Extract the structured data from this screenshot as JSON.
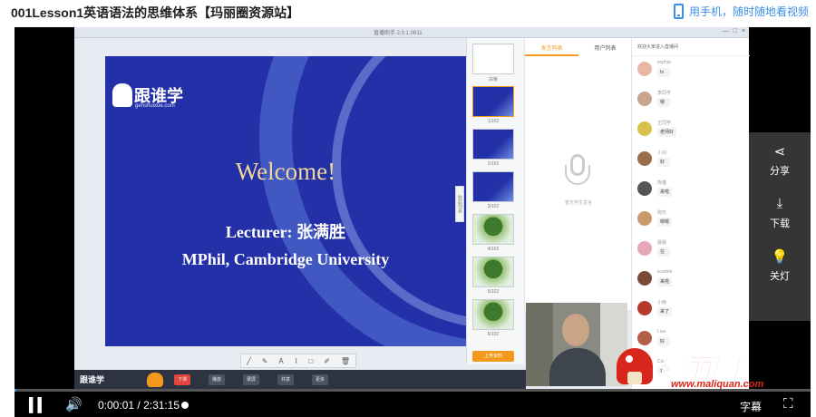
{
  "header": {
    "title": "001Lesson1英语语法的思维体系【玛丽圈资源站】",
    "mobile_hint": "用手机，随时随地看视频"
  },
  "app": {
    "title": "直播助手 2.0.1.0611",
    "window_buttons": [
      "—",
      "□",
      "×"
    ]
  },
  "slide": {
    "logo_text": "跟谁学",
    "logo_sub": "genshuixue.com",
    "welcome": "Welcome!",
    "lecturer": "Lecturer: 张满胜",
    "affiliation": "MPhil, Cambridge University"
  },
  "draw_tools": [
    "╱",
    "✎",
    "A",
    "⌇",
    "□",
    "✐",
    "🗑"
  ],
  "thumbnails": [
    {
      "label": "白板",
      "style": "white"
    },
    {
      "label": "1/102",
      "style": "blue"
    },
    {
      "label": "2/102",
      "style": "blue"
    },
    {
      "label": "3/102",
      "style": "blue"
    },
    {
      "label": "4/102",
      "style": "tree"
    },
    {
      "label": "5/102",
      "style": "tree"
    },
    {
      "label": "6/102",
      "style": "tree"
    }
  ],
  "upload_label": "上传资料",
  "side_tab_label": "收起列表",
  "mid_panel": {
    "tabs": [
      "发言列表",
      "用户列表"
    ],
    "mic_hint": "暂无学生发言"
  },
  "chat": {
    "header": "欢迎大家进入直播间",
    "messages": [
      {
        "name": "sophia",
        "text": "hi",
        "color": "#e9b7a6"
      },
      {
        "name": "李同学",
        "text": "嗯",
        "color": "#c7a58f"
      },
      {
        "name": "王同学",
        "text": "老师好",
        "color": "#d8c04a"
      },
      {
        "name": "小刘",
        "text": "好",
        "color": "#9b6e4a"
      },
      {
        "name": "熊猫",
        "text": "来啦",
        "color": "#555555"
      },
      {
        "name": "阿杰",
        "text": "嗯嗯",
        "color": "#c89a6b"
      },
      {
        "name": "晨晨",
        "text": "在",
        "color": "#e6a7b9"
      },
      {
        "name": "scarlett",
        "text": "来啦",
        "color": "#7a4a3a"
      },
      {
        "name": "小雨",
        "text": "来了",
        "color": "#b53a2c"
      },
      {
        "name": "Lisa",
        "text": "好",
        "color": "#b35e48"
      },
      {
        "name": "Cici",
        "text": "在",
        "color": "#c7d2e2"
      }
    ]
  },
  "app_bottom": {
    "logo": "跟谁学",
    "buttons": [
      {
        "label": "下课",
        "red": true
      },
      {
        "label": "播放",
        "red": false
      },
      {
        "label": "录屏",
        "red": false
      },
      {
        "label": "共享",
        "red": false
      },
      {
        "label": "更多",
        "red": false
      }
    ]
  },
  "overlay": {
    "share": "分享",
    "download": "下载",
    "lights_off": "关灯"
  },
  "watermark": {
    "brand": "玛丽圈",
    "url": "www.maliquan.com"
  },
  "player": {
    "current_time": "0:00:01",
    "total_time": "2:31:15",
    "progress": 0.0001,
    "subtitle_label": "字幕"
  },
  "colors": {
    "accent": "#3a8ee6",
    "slide_blue": "#2430a8",
    "orange": "#f39a1e",
    "watermark_red": "#d8261d"
  }
}
